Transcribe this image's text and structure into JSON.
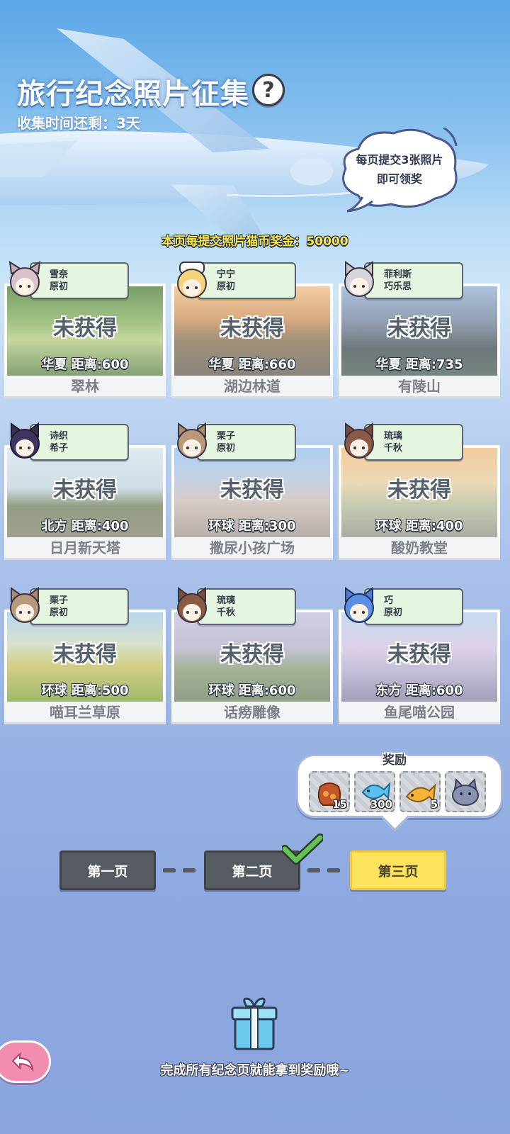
{
  "header": {
    "title": "旅行纪念照片征集",
    "help_icon": "question-mark-icon",
    "timer": "收集时间还剩：3天",
    "bubble_line1": "每页提交3张照片",
    "bubble_line2": "即可领奖",
    "bonus_text": "本页每提交照片猫币奖金：50000"
  },
  "cards": [
    {
      "char_line1": "雪奈",
      "char_line2": "原初",
      "status": "未获得",
      "distance": "华夏  距离:600",
      "name": "翠林",
      "scene": "forest"
    },
    {
      "char_line1": "宁宁",
      "char_line2": "原初",
      "status": "未获得",
      "distance": "华夏  距离:660",
      "name": "湖边林道",
      "scene": "lakepath"
    },
    {
      "char_line1": "菲利斯",
      "char_line2": "巧乐思",
      "status": "未获得",
      "distance": "华夏  距离:735",
      "name": "有陵山",
      "scene": "mountain"
    },
    {
      "char_line1": "诗织",
      "char_line2": "希子",
      "status": "未获得",
      "distance": "北方  距离:400",
      "name": "日月新天塔",
      "scene": "plain"
    },
    {
      "char_line1": "栗子",
      "char_line2": "原初",
      "status": "未获得",
      "distance": "环球  距离:300",
      "name": "撒尿小孩广场",
      "scene": "square"
    },
    {
      "char_line1": "琉璃",
      "char_line2": "千秋",
      "status": "未获得",
      "distance": "环球  距离:400",
      "name": "酸奶教堂",
      "scene": "church"
    },
    {
      "char_line1": "栗子",
      "char_line2": "原初",
      "status": "未获得",
      "distance": "环球  距离:500",
      "name": "喵耳兰草原",
      "scene": "grassland"
    },
    {
      "char_line1": "琉璃",
      "char_line2": "千秋",
      "status": "未获得",
      "distance": "环球  距离:600",
      "name": "话痨雕像",
      "scene": "statue"
    },
    {
      "char_line1": "巧",
      "char_line2": "原初",
      "status": "未获得",
      "distance": "东方  距离:600",
      "name": "鱼尾喵公园",
      "scene": "merlion"
    }
  ],
  "reward": {
    "title": "奖励",
    "items": [
      {
        "icon": "treasure-bag-icon",
        "count": "15"
      },
      {
        "icon": "blue-fish-icon",
        "count": "300"
      },
      {
        "icon": "golden-fish-icon",
        "count": "5"
      },
      {
        "icon": "cat-plush-icon",
        "count": ""
      }
    ]
  },
  "pages": {
    "page1": "第一页",
    "page2": "第二页",
    "page3": "第三页",
    "completed_icon": "checkmark-icon"
  },
  "footer": {
    "gift_icon": "gift-box-icon",
    "message": "完成所有纪念页就能拿到奖励哦~",
    "back_icon": "back-arrow-icon"
  },
  "colors": {
    "accent_yellow": "#ffe35c",
    "page_dark": "#565a61",
    "tag_green": "#e4f6df"
  }
}
